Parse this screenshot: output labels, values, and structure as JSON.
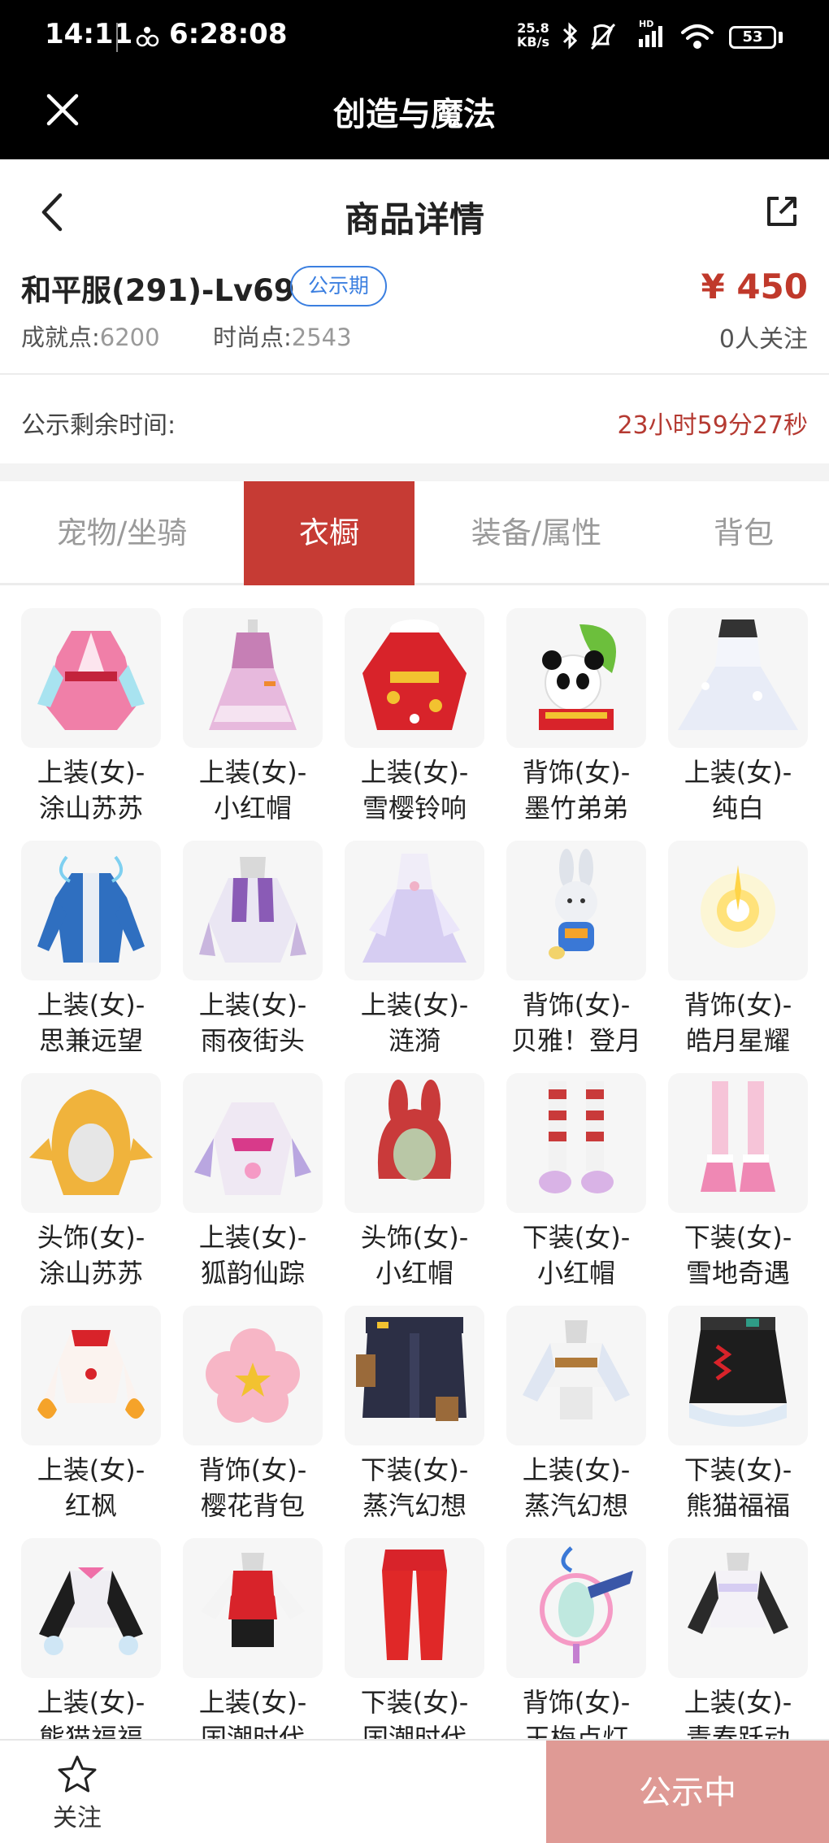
{
  "statusbar": {
    "time": "14:11",
    "clock": "6:28:08",
    "rate_value": "25.8",
    "rate_unit": "KB/s",
    "battery": "53"
  },
  "app": {
    "title": "创造与魔法"
  },
  "nav": {
    "title": "商品详情"
  },
  "product": {
    "name": "和平服(291)-Lv69",
    "badge": "公示期",
    "price": "¥ 450",
    "followers": "0人关注",
    "achievement_label": "成就点:",
    "achievement_value": "6200",
    "fashion_label": "时尚点:",
    "fashion_value": "2543"
  },
  "remain": {
    "label": "公示剩余时间:",
    "value": "23小时59分27秒"
  },
  "tabs": [
    {
      "label": "宠物/坐骑",
      "active": false
    },
    {
      "label": "衣橱",
      "active": true
    },
    {
      "label": "装备/属性",
      "active": false
    },
    {
      "label": "背包",
      "active": false
    }
  ],
  "items": [
    {
      "line1": "上装(女)-",
      "line2": "涂山苏苏",
      "icon": "pink-robe-icon"
    },
    {
      "line1": "上装(女)-",
      "line2": "小红帽",
      "icon": "lilac-dress-icon"
    },
    {
      "line1": "上装(女)-",
      "line2": "雪樱铃响",
      "icon": "red-kimono-icon"
    },
    {
      "line1": "背饰(女)-",
      "line2": "墨竹弟弟",
      "icon": "panda-icon"
    },
    {
      "line1": "上装(女)-",
      "line2": "纯白",
      "icon": "white-gown-icon"
    },
    {
      "line1": "上装(女)-",
      "line2": "思兼远望",
      "icon": "blue-jacket-icon"
    },
    {
      "line1": "上装(女)-",
      "line2": "雨夜街头",
      "icon": "purple-coat-icon"
    },
    {
      "line1": "上装(女)-",
      "line2": "涟漪",
      "icon": "lavender-gown-icon"
    },
    {
      "line1": "背饰(女)-",
      "line2": "贝雅！登月",
      "icon": "bunny-astronaut-icon"
    },
    {
      "line1": "背饰(女)-",
      "line2": "皓月星耀",
      "icon": "glow-orb-icon"
    },
    {
      "line1": "头饰(女)-",
      "line2": "涂山苏苏",
      "icon": "fox-hair-icon"
    },
    {
      "line1": "上装(女)-",
      "line2": "狐韵仙踪",
      "icon": "fox-robe-icon"
    },
    {
      "line1": "头饰(女)-",
      "line2": "小红帽",
      "icon": "red-hood-icon"
    },
    {
      "line1": "下装(女)-",
      "line2": "小红帽",
      "icon": "striped-stockings-icon"
    },
    {
      "line1": "下装(女)-",
      "line2": "雪地奇遇",
      "icon": "pink-boots-icon"
    },
    {
      "line1": "上装(女)-",
      "line2": "红枫",
      "icon": "maple-top-icon"
    },
    {
      "line1": "背饰(女)-",
      "line2": "樱花背包",
      "icon": "sakura-backpack-icon"
    },
    {
      "line1": "下装(女)-",
      "line2": "蒸汽幻想",
      "icon": "steam-skirt-icon"
    },
    {
      "line1": "上装(女)-",
      "line2": "蒸汽幻想",
      "icon": "steam-top-icon"
    },
    {
      "line1": "下装(女)-",
      "line2": "熊猫福福",
      "icon": "panda-skirt-icon"
    },
    {
      "line1": "上装(女)-",
      "line2": "熊猫福福",
      "icon": "panda-jacket-icon"
    },
    {
      "line1": "上装(女)-",
      "line2": "国潮时代",
      "icon": "red-corset-icon"
    },
    {
      "line1": "下装(女)-",
      "line2": "国潮时代",
      "icon": "red-pants-icon"
    },
    {
      "line1": "背饰(女)-",
      "line2": "玉梅点灯",
      "icon": "lantern-icon"
    },
    {
      "line1": "上装(女)-",
      "line2": "青春跃动",
      "icon": "school-top-icon"
    }
  ],
  "bottom": {
    "follow_label": "关注",
    "status_label": "公示中"
  },
  "colors": {
    "accent": "#c63b34",
    "badge": "#3b7fe0",
    "status_button": "#df9a95"
  }
}
